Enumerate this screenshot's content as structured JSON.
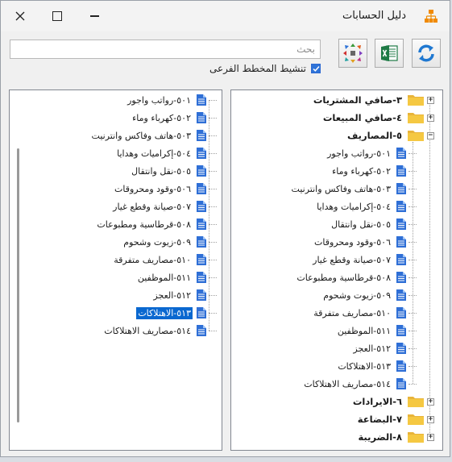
{
  "window": {
    "title": "دليل الحسابات"
  },
  "toolbar": {
    "search_placeholder": "بحث",
    "refresh_label": "refresh",
    "excel_label": "excel",
    "expand_label": "expand",
    "subplan_label": "تنشيط المخطط الفرعى",
    "subplan_checked": true
  },
  "right_tree": [
    {
      "label": "٣-صافي المشتريات",
      "type": "parent",
      "expander": "+"
    },
    {
      "label": "٤-صافي المبيعات",
      "type": "parent",
      "expander": "+"
    },
    {
      "label": "٥-المصاريف",
      "type": "parent",
      "expander": "−"
    },
    {
      "label": "٥٠١-رواتب واجور",
      "type": "child"
    },
    {
      "label": "٥٠٢-كهرباء وماء",
      "type": "child"
    },
    {
      "label": "٥٠٣-هاتف وفاكس وانترنيت",
      "type": "child"
    },
    {
      "label": "٥٠٤-إكراميات وهدايا",
      "type": "child"
    },
    {
      "label": "٥٠٥-نقل وانتقال",
      "type": "child"
    },
    {
      "label": "٥٠٦-وقود ومحروقات",
      "type": "child"
    },
    {
      "label": "٥٠٧-صيانة وقطع غيار",
      "type": "child"
    },
    {
      "label": "٥٠٨-قرطاسية ومطبوعات",
      "type": "child"
    },
    {
      "label": "٥٠٩-زيوت وشحوم",
      "type": "child"
    },
    {
      "label": "٥١٠-مصاريف متفرقة",
      "type": "child"
    },
    {
      "label": "٥١١-الموظفين",
      "type": "child"
    },
    {
      "label": "٥١٢-العجز",
      "type": "child"
    },
    {
      "label": "٥١٣-الاهتلاكات",
      "type": "child"
    },
    {
      "label": "٥١٤-مصاريف الاهتلاكات",
      "type": "child"
    },
    {
      "label": "٦-الايرادات",
      "type": "parent",
      "expander": "+"
    },
    {
      "label": "٧-البضاعة",
      "type": "parent",
      "expander": "+"
    },
    {
      "label": "٨-الضريبة",
      "type": "parent",
      "expander": "+"
    }
  ],
  "left_list": [
    {
      "label": "٥٠١-رواتب واجور"
    },
    {
      "label": "٥٠٢-كهرباء وماء"
    },
    {
      "label": "٥٠٣-هاتف وفاكس وانترنيت"
    },
    {
      "label": "٥٠٤-إكراميات وهدايا"
    },
    {
      "label": "٥٠٥-نقل وانتقال"
    },
    {
      "label": "٥٠٦-وقود ومحروقات"
    },
    {
      "label": "٥٠٧-صيانة وقطع غيار"
    },
    {
      "label": "٥٠٨-قرطاسية ومطبوعات"
    },
    {
      "label": "٥٠٩-زيوت وشحوم"
    },
    {
      "label": "٥١٠-مصاريف متفرقة"
    },
    {
      "label": "٥١١-الموظفين"
    },
    {
      "label": "٥١٢-العجز"
    },
    {
      "label": "٥١٣-الاهتلاكات",
      "selected": true
    },
    {
      "label": "٥١٤-مصاريف الاهتلاكات"
    }
  ],
  "colors": {
    "accent": "#0a68d0",
    "folder": "#f5c842",
    "doc": "#2f6fd6",
    "excel": "#1e7a45"
  }
}
